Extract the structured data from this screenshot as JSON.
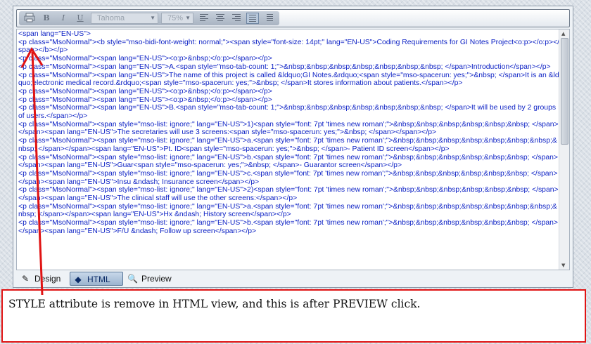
{
  "toolbar": {
    "bold_glyph": "B",
    "italic_glyph": "I",
    "underline_glyph": "U",
    "font_family": "Tahoma",
    "zoom": "75%",
    "icons": [
      "print-icon",
      "bold-icon",
      "italic-icon",
      "underline-icon",
      "align-left-icon",
      "align-center-icon",
      "align-right-icon",
      "align-justify-icon",
      "list-icon"
    ]
  },
  "code_lines": [
    "<span lang=\"EN-US\">",
    "<p class=\"MsoNormal\"><b style=\"mso-bidi-font-weight: normal;\"><span style=\"font-size: 14pt;\" lang=\"EN-US\">Coding Requirements for GI Notes Project<o:p></o:p></span></b></p>",
    "<p class=\"MsoNormal\"><span lang=\"EN-US\"><o:p>&nbsp;</o:p></span></p>",
    "<p class=\"MsoNormal\"><span lang=\"EN-US\">A.<span style=\"mso-tab-count: 1;\">&nbsp;&nbsp;&nbsp;&nbsp;&nbsp;&nbsp;&nbsp; </span>Introduction</span></p>",
    "<p class=\"MsoNormal\"><span lang=\"EN-US\">The name of this project is called &ldquo;GI Notes.&rdquo;<span style=\"mso-spacerun: yes;\">&nbsp; </span>It is an &ldquo;electronic medical record.&rdquo;<span style=\"mso-spacerun: yes;\">&nbsp; </span>It stores information about patients.</span></p>",
    "<p class=\"MsoNormal\"><span lang=\"EN-US\"><o:p>&nbsp;</o:p></span></p>",
    "<p class=\"MsoNormal\"><span lang=\"EN-US\"><o:p>&nbsp;</o:p></span></p>",
    "<p class=\"MsoNormal\"><span lang=\"EN-US\">B.<span style=\"mso-tab-count: 1;\">&nbsp;&nbsp;&nbsp;&nbsp;&nbsp;&nbsp;&nbsp; </span>It will be used by 2 groups of users.</span></p>",
    "<p class=\"MsoNormal\"><span style=\"mso-list: ignore;\" lang=\"EN-US\">1)<span style=\"font: 7pt 'times new roman';\">&nbsp;&nbsp;&nbsp;&nbsp;&nbsp;&nbsp; </span></span><span lang=\"EN-US\">The secretaries will use 3 screens:<span style=\"mso-spacerun: yes;\">&nbsp; </span></span></p>",
    "<p class=\"MsoNormal\"><span style=\"mso-list: ignore;\" lang=\"EN-US\">a.<span style=\"font: 7pt 'times new roman';\">&nbsp;&nbsp;&nbsp;&nbsp;&nbsp;&nbsp;&nbsp;&nbsp; </span></span><span lang=\"EN-US\">Pt. ID<span style=\"mso-spacerun: yes;\">&nbsp; </span>- Patient ID screen</span></p>",
    "<p class=\"MsoNormal\"><span style=\"mso-list: ignore;\" lang=\"EN-US\">b.<span style=\"font: 7pt 'times new roman';\">&nbsp;&nbsp;&nbsp;&nbsp;&nbsp;&nbsp; </span></span><span lang=\"EN-US\">Guar<span style=\"mso-spacerun: yes;\">&nbsp; </span>- Guarantor screen</span></p>",
    "<p class=\"MsoNormal\"><span style=\"mso-list: ignore;\" lang=\"EN-US\">c.<span style=\"font: 7pt 'times new roman';\">&nbsp;&nbsp;&nbsp;&nbsp;&nbsp;&nbsp; </span></span><span lang=\"EN-US\">Insu &ndash; Insurance screen</span></p>",
    "<p class=\"MsoNormal\"><span style=\"mso-list: ignore;\" lang=\"EN-US\">2)<span style=\"font: 7pt 'times new roman';\">&nbsp;&nbsp;&nbsp;&nbsp;&nbsp;&nbsp; </span></span><span lang=\"EN-US\">The clinical staff will use the other screens:</span></p>",
    "<p class=\"MsoNormal\"><span style=\"mso-list: ignore;\" lang=\"EN-US\">a.<span style=\"font: 7pt 'times new roman';\">&nbsp;&nbsp;&nbsp;&nbsp;&nbsp;&nbsp;&nbsp;&nbsp; </span></span><span lang=\"EN-US\">Hx &ndash; History screen</span></p>",
    "<p class=\"MsoNormal\"><span style=\"mso-list: ignore;\" lang=\"EN-US\">b.<span style=\"font: 7pt 'times new roman';\">&nbsp;&nbsp;&nbsp;&nbsp;&nbsp;&nbsp; </span></span><span lang=\"EN-US\">F/U &ndash; Follow up screen</span></p>"
  ],
  "tabs": [
    {
      "label": "Design",
      "icon": "pencil-icon"
    },
    {
      "label": "HTML",
      "icon": "code-icon"
    },
    {
      "label": "Preview",
      "icon": "magnifier-icon"
    }
  ],
  "annotation": {
    "text": "STYLE attribute is remove in HTML view, and this is after PREVIEW click.",
    "color": "#e01313"
  }
}
